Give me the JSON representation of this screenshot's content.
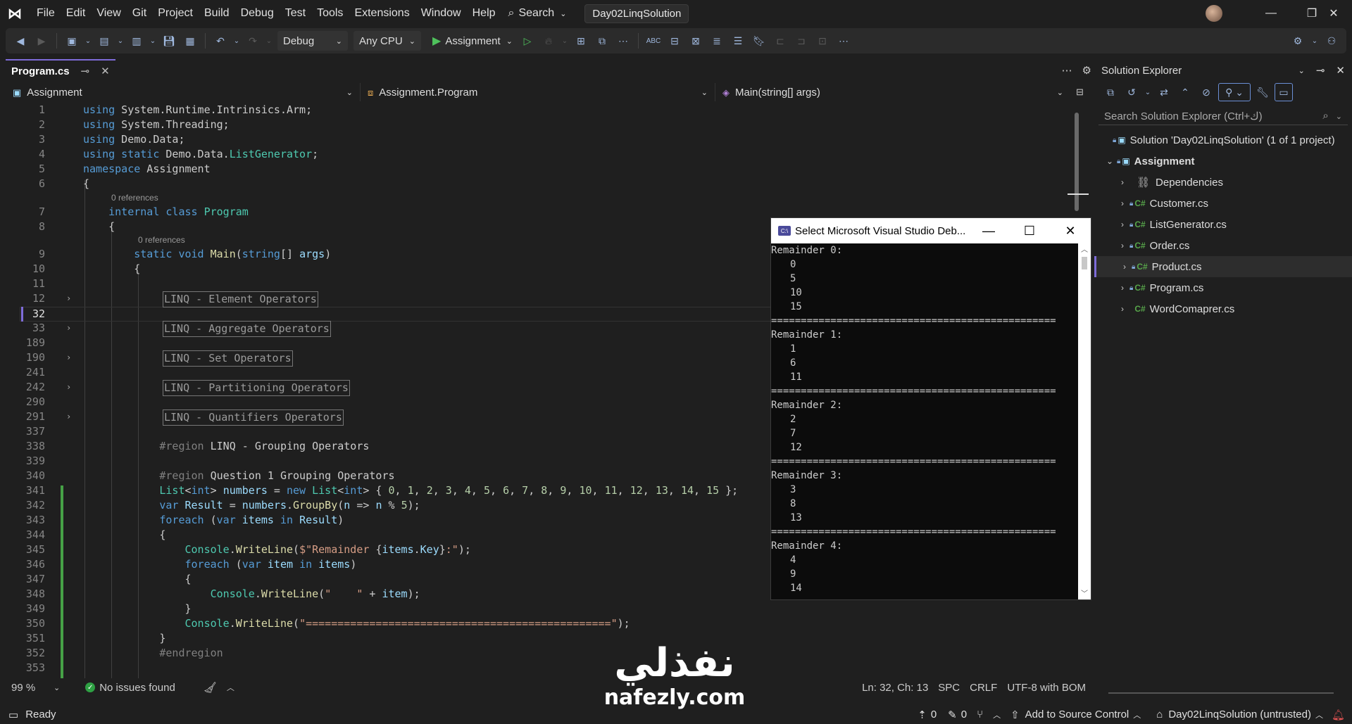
{
  "menubar": {
    "items": [
      "File",
      "Edit",
      "View",
      "Git",
      "Project",
      "Build",
      "Debug",
      "Test",
      "Tools",
      "Extensions",
      "Window",
      "Help"
    ],
    "search_label": "Search",
    "solution_name": "Day02LinqSolution"
  },
  "toolbar": {
    "config": "Debug",
    "platform": "Any CPU",
    "run_target": "Assignment"
  },
  "doc_tab": {
    "label": "Program.cs"
  },
  "navbar": {
    "project": "Assignment",
    "type": "Assignment.Program",
    "member": "Main(string[] args)"
  },
  "editor": {
    "codelens": "0 references",
    "zoom": "99 %",
    "issues": "No issues found",
    "position": "Ln: 32, Ch: 13",
    "spc": "SPC",
    "eol": "CRLF",
    "encoding": "UTF-8 with BOM",
    "line_numbers": [
      "1",
      "2",
      "3",
      "4",
      "5",
      "6",
      "7",
      "8",
      "9",
      "10",
      "11",
      "12",
      "32",
      "33",
      "189",
      "190",
      "241",
      "242",
      "290",
      "291",
      "337",
      "338",
      "339",
      "340",
      "341",
      "342",
      "343",
      "344",
      "345",
      "346",
      "347",
      "348",
      "349",
      "350",
      "351",
      "352",
      "353"
    ],
    "regions": [
      "LINQ - Element Operators",
      "LINQ - Aggregate Operators",
      "LINQ - Set Operators",
      "LINQ - Partitioning Operators",
      "LINQ - Quantifiers Operators"
    ]
  },
  "console": {
    "title": "Select Microsoft Visual Studio Deb...",
    "separator": "================================================",
    "groups": [
      {
        "header": "Remainder 0:",
        "items": [
          "0",
          "5",
          "10",
          "15"
        ]
      },
      {
        "header": "Remainder 1:",
        "items": [
          "1",
          "6",
          "11"
        ]
      },
      {
        "header": "Remainder 2:",
        "items": [
          "2",
          "7",
          "12"
        ]
      },
      {
        "header": "Remainder 3:",
        "items": [
          "3",
          "8",
          "13"
        ]
      },
      {
        "header": "Remainder 4:",
        "items": [
          "4",
          "9",
          "14"
        ]
      }
    ]
  },
  "solution_explorer": {
    "title": "Solution Explorer",
    "search_placeholder": "Search Solution Explorer (Ctrl+ك)",
    "solution": "Solution 'Day02LinqSolution' (1 of 1 project)",
    "project": "Assignment",
    "dependencies": "Dependencies",
    "files": [
      "Customer.cs",
      "ListGenerator.cs",
      "Order.cs",
      "Product.cs",
      "Program.cs",
      "WordComaprer.cs"
    ]
  },
  "statusbar": {
    "ready": "Ready",
    "up_count": "0",
    "pencil_count": "0",
    "source_control": "Add to Source Control",
    "repo": "Day02LinqSolution (untrusted)"
  },
  "watermark": {
    "arabic": "نفذلي",
    "latin": "nafezly.com"
  }
}
